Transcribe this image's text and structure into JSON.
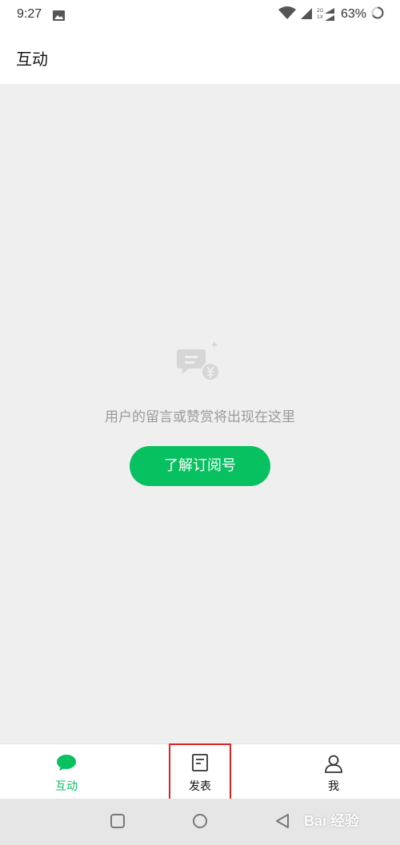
{
  "status_bar": {
    "time": "9:27",
    "battery_percent": "63%",
    "signal_labels": [
      "2G",
      "1X"
    ]
  },
  "header": {
    "title": "互动"
  },
  "empty_state": {
    "message": "用户的留言或赞赏将出现在这里",
    "button_label": "了解订阅号",
    "icon": "comment-reward-icon"
  },
  "tabbar": {
    "tabs": [
      {
        "label": "互动",
        "icon": "chat-bubble-icon",
        "active": true
      },
      {
        "label": "发表",
        "icon": "document-icon",
        "active": false
      },
      {
        "label": "我",
        "icon": "person-icon",
        "active": false
      }
    ]
  },
  "system_nav": {
    "buttons": [
      "recents-icon",
      "home-icon",
      "back-icon"
    ]
  },
  "watermark": {
    "text": "Bai  经验"
  },
  "colors": {
    "accent": "#07c160",
    "background": "#efefef",
    "highlight": "#e02020"
  }
}
